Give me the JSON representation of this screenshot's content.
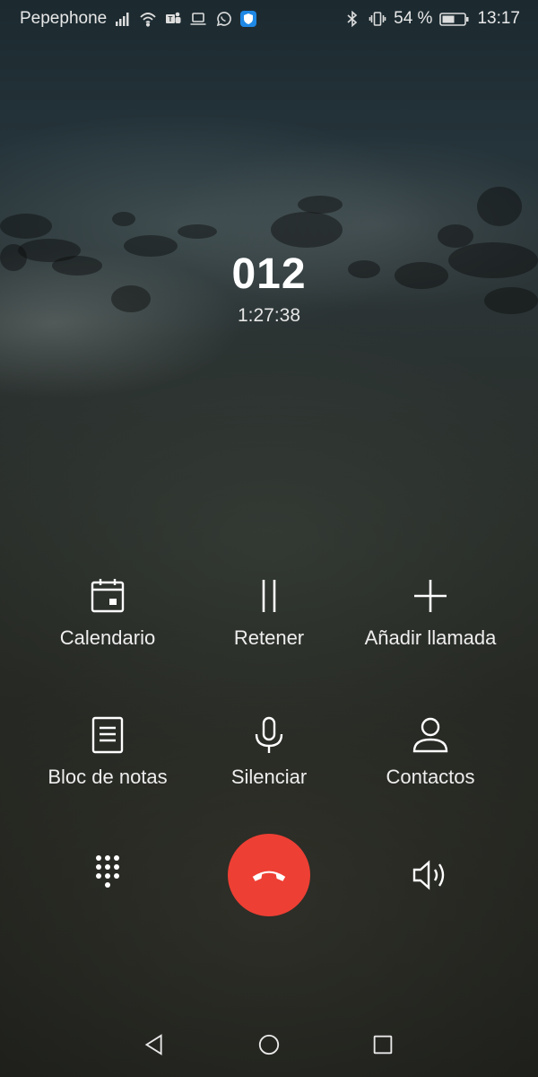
{
  "status_bar": {
    "carrier": "Pepephone",
    "battery_percent": "54 %",
    "time": "13:17",
    "left_icons": [
      "signal-icon",
      "wifi-icon",
      "teams-icon",
      "laptop-icon",
      "whatsapp-icon",
      "shield-icon"
    ],
    "right_icons": [
      "bluetooth-icon",
      "vibrate-icon",
      "battery-icon"
    ]
  },
  "call": {
    "number": "012",
    "duration": "1:27:38"
  },
  "actions": {
    "calendar": "Calendario",
    "hold": "Retener",
    "add_call": "Añadir llamada",
    "notepad": "Bloc de notas",
    "mute": "Silenciar",
    "contacts": "Contactos"
  },
  "controls": {
    "dialpad_icon": "dialpad-icon",
    "end_call_icon": "end-call-icon",
    "speaker_icon": "speaker-icon",
    "end_call_color": "#ee3f34"
  },
  "nav": {
    "icons": [
      "back-icon",
      "home-icon",
      "recents-icon"
    ]
  }
}
